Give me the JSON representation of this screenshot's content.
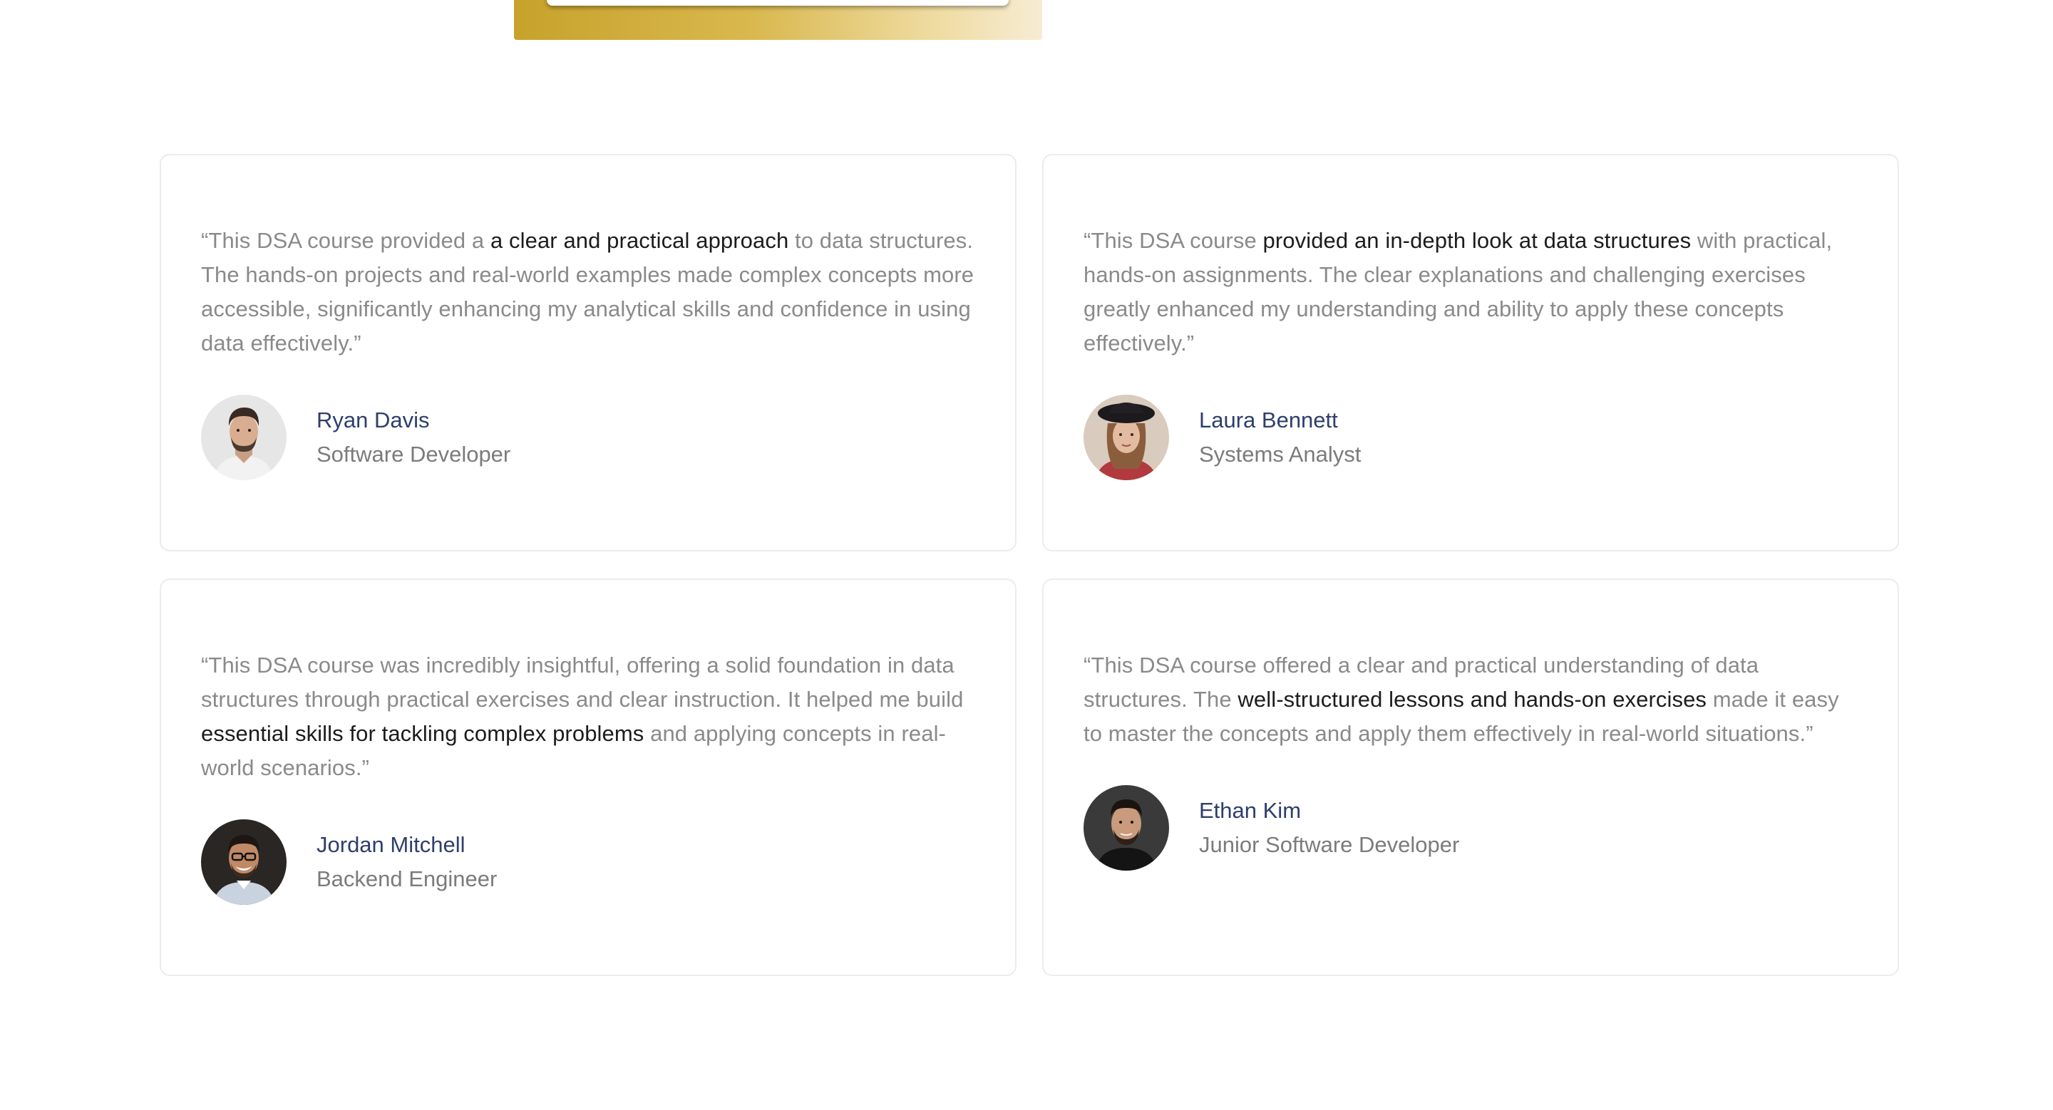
{
  "testimonials": [
    {
      "quote_parts": [
        {
          "text": "“This DSA course provided a ",
          "highlight": false
        },
        {
          "text": "a clear and practical approach",
          "highlight": true
        },
        {
          "text": " to data structures. The hands-on projects and real-world examples made complex concepts more accessible, significantly enhancing my analytical skills and confidence in using data effectively.”",
          "highlight": false
        }
      ],
      "name": "Ryan Davis",
      "role": "Software Developer",
      "avatar_icon": "avatar-ryan-davis"
    },
    {
      "quote_parts": [
        {
          "text": "“This DSA course ",
          "highlight": false
        },
        {
          "text": "provided an in-depth look at data structures",
          "highlight": true
        },
        {
          "text": " with practical, hands-on assignments. The clear explanations and challenging exercises greatly enhanced my understanding and ability to apply these concepts effectively.”",
          "highlight": false
        }
      ],
      "name": "Laura Bennett",
      "role": "Systems Analyst",
      "avatar_icon": "avatar-laura-bennett"
    },
    {
      "quote_parts": [
        {
          "text": "“This DSA course was incredibly insightful, offering a solid foundation in data structures through practical exercises and clear instruction. It helped me build ",
          "highlight": false
        },
        {
          "text": "essential skills for tackling complex problems",
          "highlight": true
        },
        {
          "text": " and applying concepts in real-world scenarios.”",
          "highlight": false
        }
      ],
      "name": "Jordan Mitchell",
      "role": "Backend Engineer",
      "avatar_icon": "avatar-jordan-mitchell"
    },
    {
      "quote_parts": [
        {
          "text": "“This DSA course offered a clear and practical understanding of data structures. The ",
          "highlight": false
        },
        {
          "text": "well-structured lessons and hands-on exercises",
          "highlight": true
        },
        {
          "text": " made it easy to master the concepts and apply them effectively in real-world situations.”",
          "highlight": false
        }
      ],
      "name": "Ethan Kim",
      "role": "Junior Software Developer",
      "avatar_icon": "avatar-ethan-kim"
    }
  ],
  "colors": {
    "quote_text": "#8a8a8a",
    "quote_highlight": "#1c1c1c",
    "author_name": "#2f3f6b",
    "author_role": "#7b7b7b",
    "card_border": "#ececec",
    "hero_gold": "#c7a22b"
  }
}
